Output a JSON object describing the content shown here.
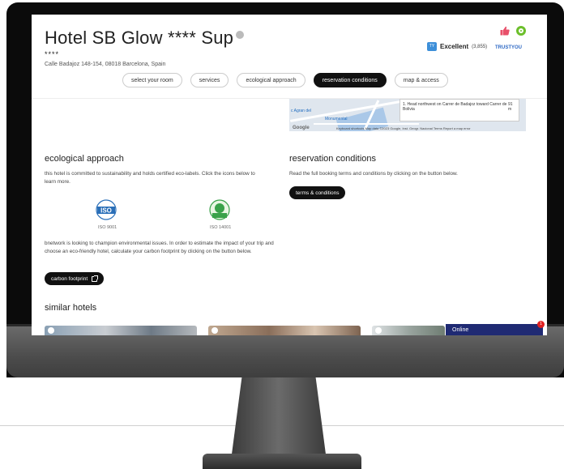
{
  "header": {
    "hotel_name": "Hotel SB Glow **** Sup",
    "stars": "****",
    "address": "Calle Badajoz 148-154, 08018 Barcelona, Spain",
    "rating_label": "Excellent",
    "rating_count": "(3,855)",
    "rating_provider": "TRUSTYOU",
    "accent_color": "#111111",
    "eco_color": "#6cbf2b"
  },
  "tabs": [
    {
      "label": "select your room"
    },
    {
      "label": "services"
    },
    {
      "label": "ecological approach"
    },
    {
      "label": "reservation conditions",
      "active": true
    },
    {
      "label": "map & access"
    }
  ],
  "map": {
    "place_1": "c Agran del",
    "place_2": "Monumental",
    "directions_step": "1. Head northwest on Carrer de Badajoz toward Carrer de Bolivia",
    "directions_distance": "91 m",
    "credits": "Keyboard shortcuts   Map data ©2023 Google, Inst. Geogr. Nacional   Terms   Report a map error",
    "google_label": "Google"
  },
  "ecological": {
    "title": "ecological approach",
    "intro": "this hotel is committed to sustainability and holds certified eco-labels. Click the icons below to learn more.",
    "labels": [
      {
        "name": "ISO 9001",
        "icon": "iso-9001-icon"
      },
      {
        "name": "ISO 14001",
        "icon": "iso-14001-icon"
      }
    ],
    "carbon_text": "bnetwork is looking to champion environmental issues. In order to estimate the impact of your trip and choose an eco-friendly hotel, calculate your carbon footprint by clicking on the button below.",
    "carbon_button": "carbon footprint"
  },
  "reservation": {
    "title": "reservation conditions",
    "text": "Read the full booking terms and conditions by clicking on the button below.",
    "button": "terms & conditions"
  },
  "similar": {
    "title": "similar hotels"
  },
  "chat": {
    "label": "Online",
    "badge": "1"
  }
}
